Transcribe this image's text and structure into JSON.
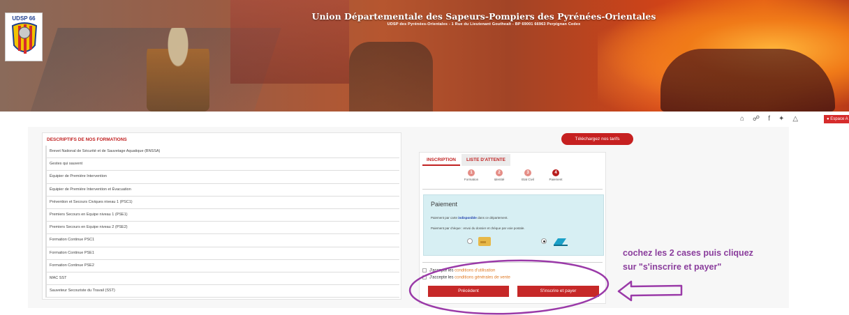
{
  "header": {
    "title": "Union Départementale des Sapeurs-Pompiers des Pyrénées-Orientales",
    "subtitle": "UDSP des Pyrénées-Orientales - 1 Rue du Lieutenant Gouthealt - BP 69001 66963 Perpignan Cedex",
    "logo_text": "UDSP 66"
  },
  "topbar": {
    "icons": [
      "home-icon",
      "globe-icon",
      "facebook-icon",
      "twitter-icon",
      "sitemap-icon"
    ],
    "espace_label": "Espace A"
  },
  "formations": {
    "title": "DESCRIPTIFS DE NOS FORMATIONS",
    "items": [
      "Brevet National de Sécurité et de Sauvetage Aquatique (BNSSA)",
      "Gestes qui sauvent",
      "Équipier de Première Intervention",
      "Équipier de Première Intervention et Évacuation",
      "Prévention et Secours Civiques niveau 1 (PSC1)",
      "Premiers Secours en Equipe niveau 1 (PSE1)",
      "Premiers Secours en Equipe niveau 2 (PSE2)",
      "Formation Continue PSC1",
      "Formation Continue PSE1",
      "Formation Continue PSE2",
      "MAC SST",
      "Sauveteur Secouriste du Travail (SST)"
    ]
  },
  "tarifs_label": "Téléchargez nos tarifs",
  "inscription": {
    "tabs": [
      "INSCRIPTION",
      "LISTE D'ATTENTE"
    ],
    "steps": [
      {
        "num": "1",
        "label": "Formation"
      },
      {
        "num": "2",
        "label": "Identité"
      },
      {
        "num": "3",
        "label": "Etat Civil"
      },
      {
        "num": "4",
        "label": "Paiement"
      }
    ],
    "current_step": 4,
    "payment": {
      "title": "Paiement",
      "line1_prefix": "Paiement par carte",
      "line1_bold": "indisponible",
      "line1_suffix": "dans ce département.",
      "line2": "Paiement par chèque : envoi du dossier et chèque par voie postale.",
      "options": [
        "carte",
        "cheque"
      ],
      "selected": "cheque"
    },
    "cgu_prefix": "J'accepte les",
    "cgu_link": "conditions d'utilisation",
    "cgv_prefix": "J'accepte les",
    "cgv_link": "conditions générales de vente",
    "prev_label": "Précédent",
    "pay_label": "S'inscrire et payer"
  },
  "annotation": {
    "line1": "cochez les 2 cases puis cliquez",
    "line2": "sur \"s'inscrire et payer\"",
    "color": "#8a3d9c"
  }
}
